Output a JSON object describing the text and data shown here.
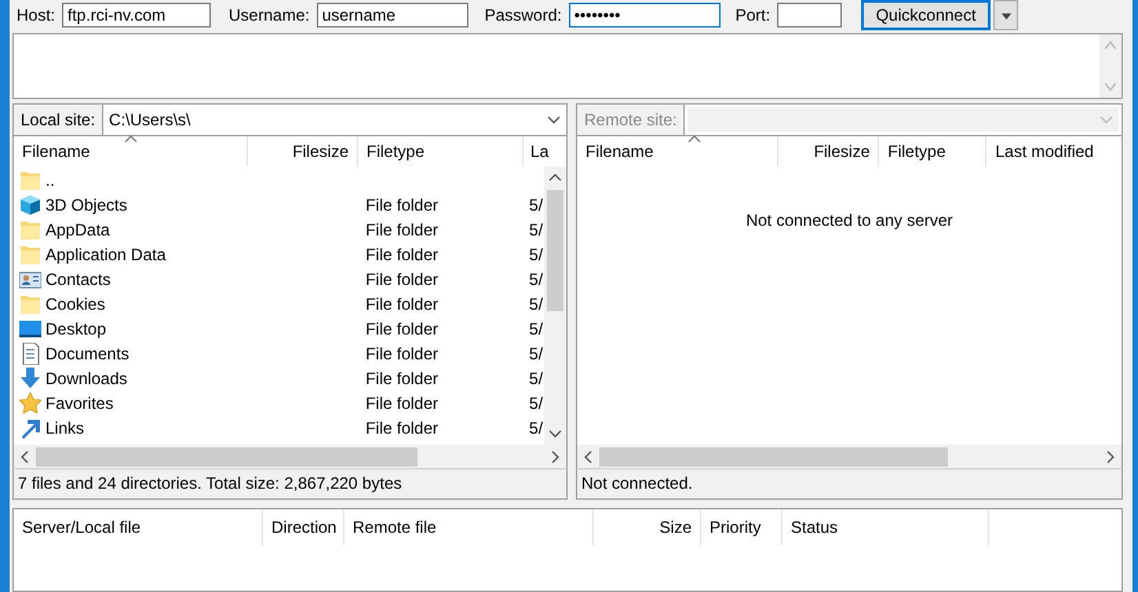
{
  "quickconnect": {
    "fields": [
      {
        "label": "Host:",
        "value": "ftp.rci-nv.com",
        "focused": false
      },
      {
        "label": "Username:",
        "value": "username",
        "focused": false
      },
      {
        "label": "Password:",
        "value": "••••••••",
        "focused": true
      },
      {
        "label": "Port:",
        "focused": false
      }
    ],
    "button": "Quickconnect"
  },
  "local": {
    "site_label": "Local site:",
    "path": "C:\\Users\\s\\",
    "columns": [
      {
        "label": "Filename"
      },
      {
        "label": "Filesize"
      },
      {
        "label": "Filetype"
      },
      {
        "label": "La"
      }
    ],
    "rows": [
      {
        "name": "..",
        "kind": "folder"
      },
      {
        "name": "3D Objects",
        "kind": "cube",
        "type": "File folder",
        "modified": "5/"
      },
      {
        "name": "AppData",
        "kind": "folder",
        "type": "File folder",
        "modified": "5/"
      },
      {
        "name": "Application Data",
        "kind": "folder",
        "type": "File folder",
        "modified": "5/"
      },
      {
        "name": "Contacts",
        "kind": "contacts",
        "type": "File folder",
        "modified": "5/"
      },
      {
        "name": "Cookies",
        "kind": "folder",
        "type": "File folder",
        "modified": "5/"
      },
      {
        "name": "Desktop",
        "kind": "desktop",
        "type": "File folder",
        "modified": "5/"
      },
      {
        "name": "Documents",
        "kind": "documents",
        "type": "File folder",
        "modified": "5/"
      },
      {
        "name": "Downloads",
        "kind": "downloads",
        "type": "File folder",
        "modified": "5/"
      },
      {
        "name": "Favorites",
        "kind": "favorites",
        "type": "File folder",
        "modified": "5/"
      },
      {
        "name": "Links",
        "kind": "links",
        "type": "File folder",
        "modified": "5/"
      }
    ],
    "status": "7 files and 24 directories. Total size: 2,867,220 bytes"
  },
  "remote": {
    "site_label": "Remote site:",
    "disabled": true,
    "columns": [
      {
        "label": "Filename"
      },
      {
        "label": "Filesize"
      },
      {
        "label": "Filetype"
      },
      {
        "label": "Last modified"
      }
    ],
    "empty_message": "Not connected to any server",
    "status": "Not connected."
  },
  "queue": {
    "columns": [
      {
        "label": "Server/Local file"
      },
      {
        "label": "Direction"
      },
      {
        "label": "Remote file"
      },
      {
        "label": "Size"
      },
      {
        "label": "Priority"
      },
      {
        "label": "Status"
      }
    ]
  }
}
